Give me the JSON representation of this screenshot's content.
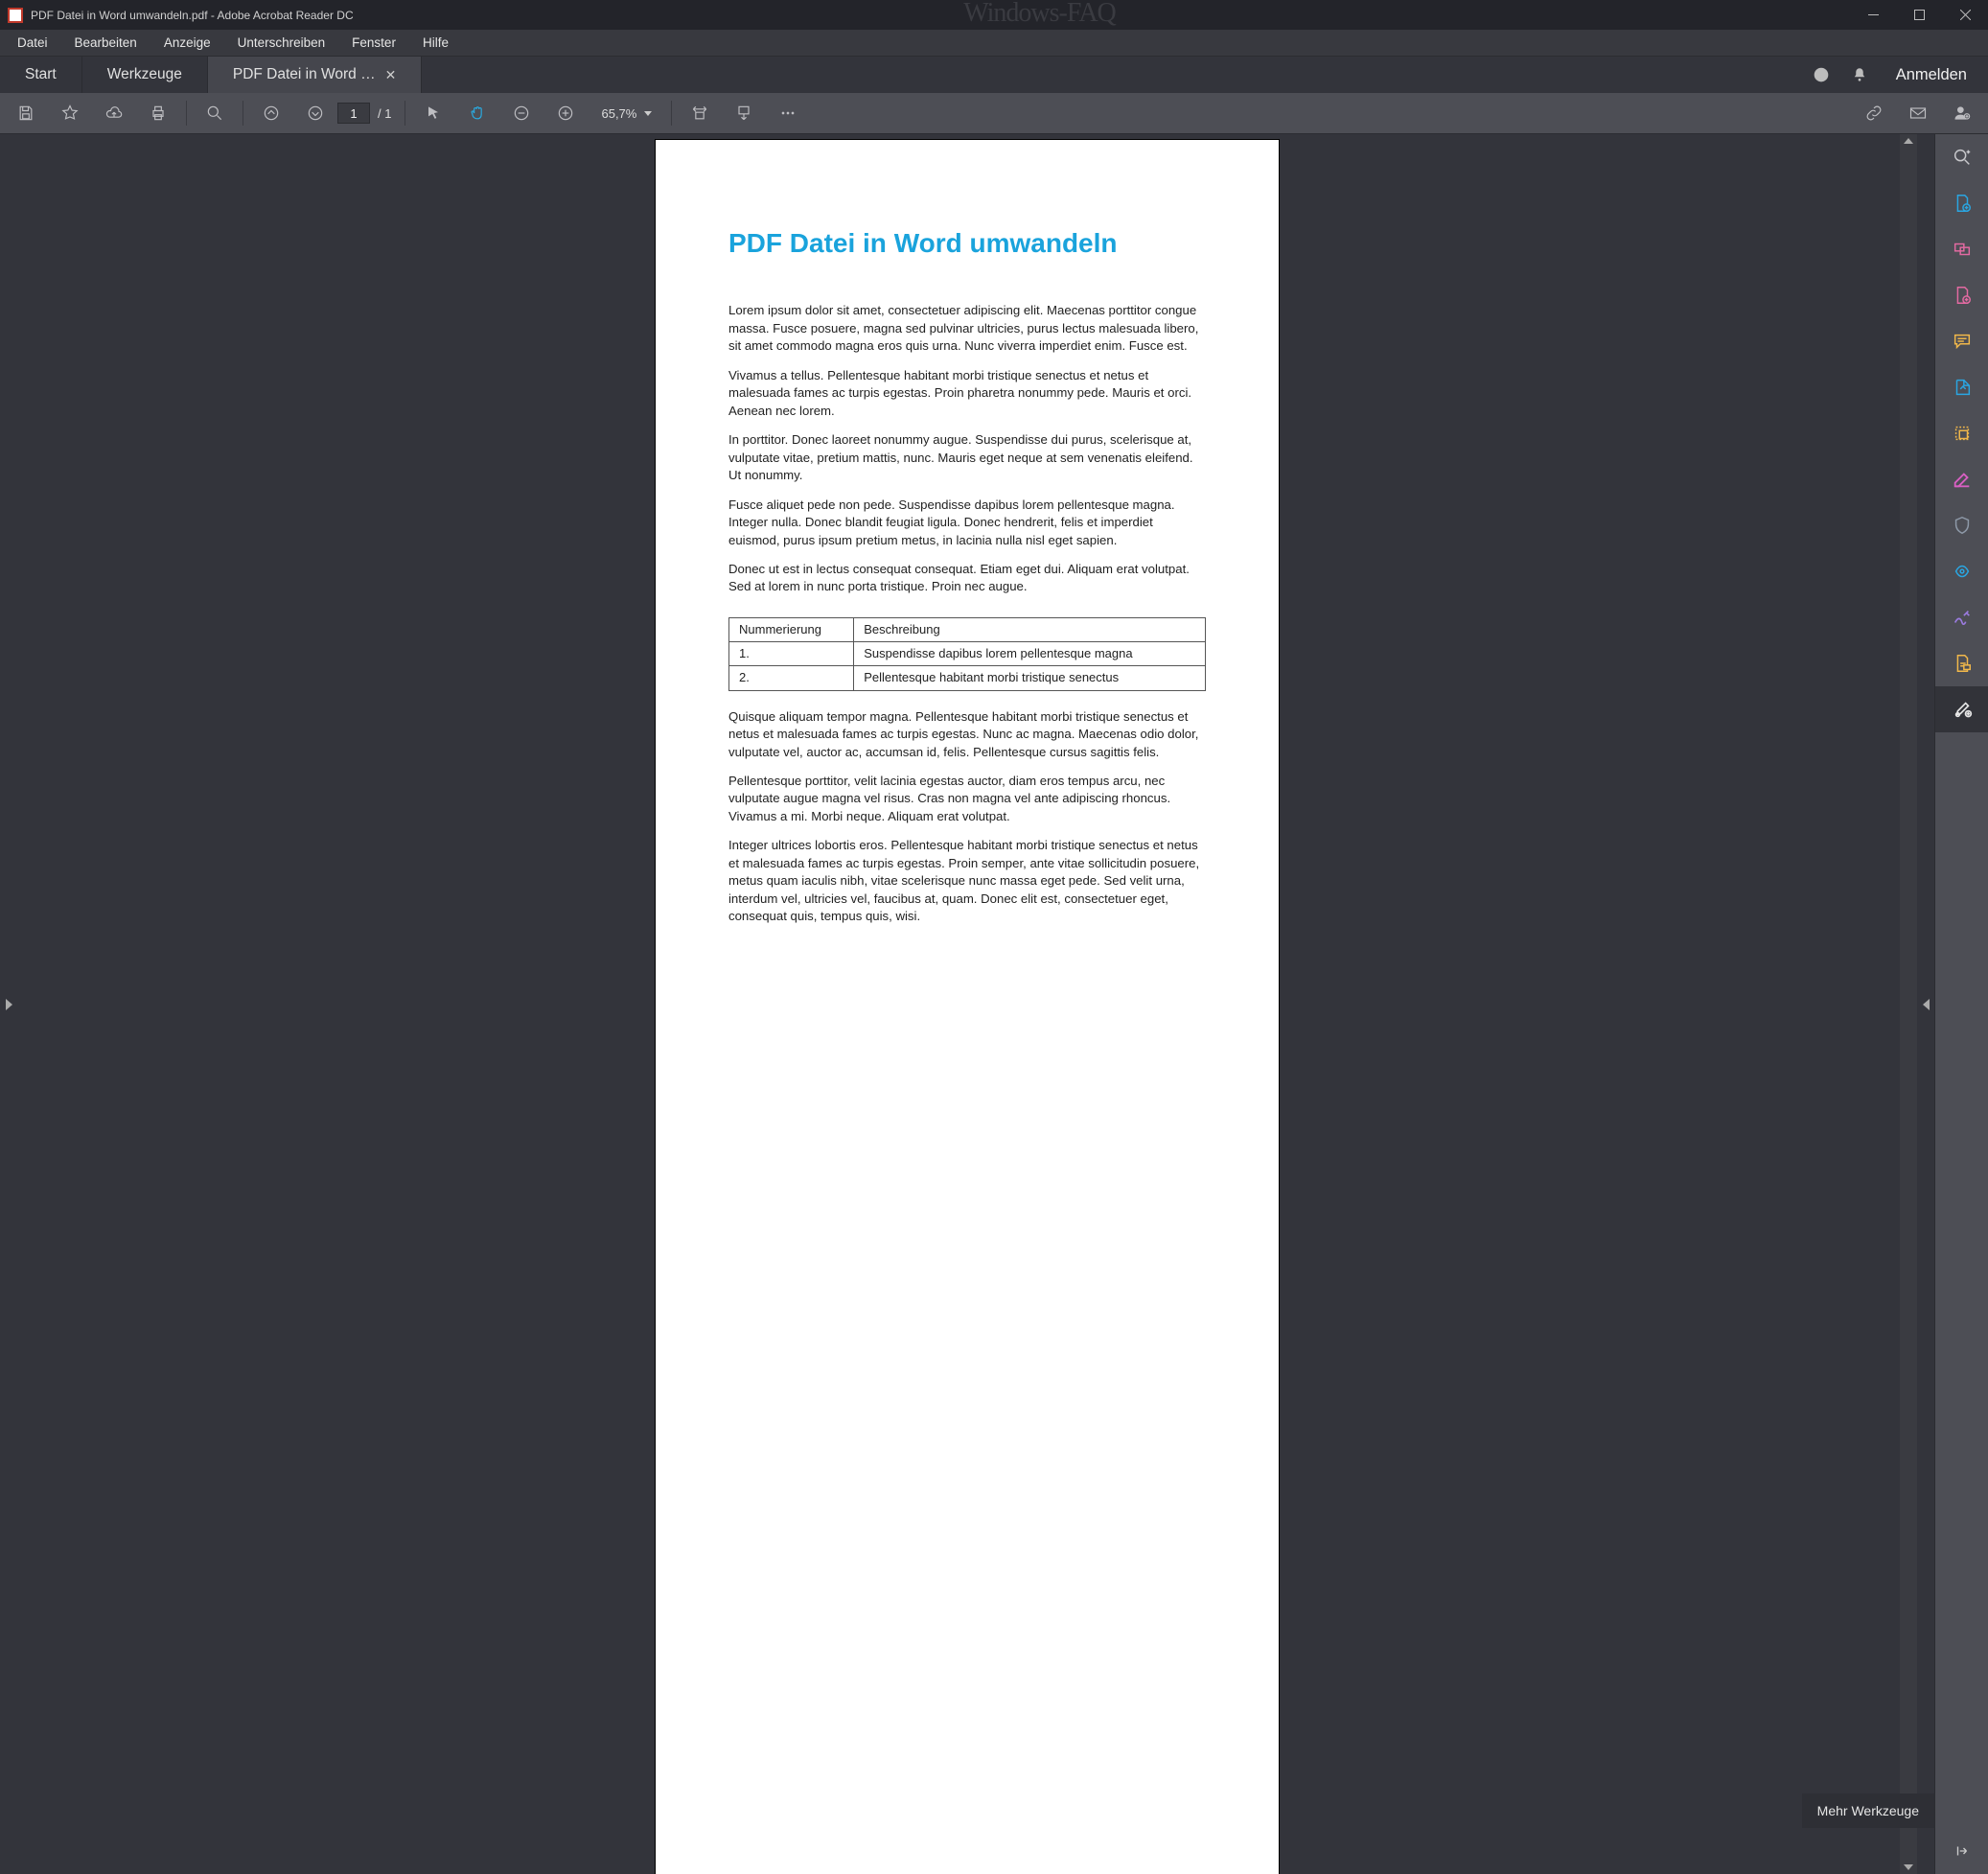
{
  "window": {
    "title": "PDF Datei in Word umwandeln.pdf - Adobe Acrobat Reader DC",
    "watermark": "Windows-FAQ"
  },
  "menu": {
    "datei": "Datei",
    "bearbeiten": "Bearbeiten",
    "anzeige": "Anzeige",
    "unterschreiben": "Unterschreiben",
    "fenster": "Fenster",
    "hilfe": "Hilfe"
  },
  "tabs": {
    "start": "Start",
    "tools": "Werkzeuge",
    "doc": "PDF Datei in Word …"
  },
  "actions": {
    "login": "Anmelden"
  },
  "toolbar": {
    "page_current": "1",
    "page_total_prefix": "/",
    "page_total": "1",
    "zoom": "65,7%"
  },
  "tooltip": {
    "more_tools": "Mehr Werkzeuge"
  },
  "doc": {
    "heading": "PDF Datei in Word umwandeln",
    "p1": "Lorem ipsum dolor sit amet, consectetuer adipiscing elit. Maecenas porttitor congue massa. Fusce posuere, magna sed pulvinar ultricies, purus lectus malesuada libero, sit amet commodo magna eros quis urna. Nunc viverra imperdiet enim. Fusce est.",
    "p2": "Vivamus a tellus. Pellentesque habitant morbi tristique senectus et netus et malesuada fames ac turpis egestas. Proin pharetra nonummy pede. Mauris et orci. Aenean nec lorem.",
    "p3": "In porttitor. Donec laoreet nonummy augue. Suspendisse dui purus, scelerisque at, vulputate vitae, pretium mattis, nunc. Mauris eget neque at sem venenatis eleifend. Ut nonummy.",
    "p4": "Fusce aliquet pede non pede. Suspendisse dapibus lorem pellentesque magna. Integer nulla. Donec blandit feugiat ligula. Donec hendrerit, felis et imperdiet euismod, purus ipsum pretium metus, in lacinia nulla nisl eget sapien.",
    "p5": "Donec ut est in lectus consequat consequat. Etiam eget dui. Aliquam erat volutpat. Sed at lorem in nunc porta tristique. Proin nec augue.",
    "table": {
      "h1": "Nummerierung",
      "h2": "Beschreibung",
      "r1c1": "1.",
      "r1c2": "Suspendisse dapibus lorem pellentesque magna",
      "r2c1": "2.",
      "r2c2": "Pellentesque habitant morbi tristique senectus"
    },
    "p6": "Quisque aliquam tempor magna. Pellentesque habitant morbi tristique senectus et netus et malesuada fames ac turpis egestas. Nunc ac magna. Maecenas odio dolor, vulputate vel, auctor ac, accumsan id, felis. Pellentesque cursus sagittis felis.",
    "p7": "Pellentesque porttitor, velit lacinia egestas auctor, diam eros tempus arcu, nec vulputate augue magna vel risus. Cras non magna vel ante adipiscing rhoncus. Vivamus a mi. Morbi neque. Aliquam erat volutpat.",
    "p8": "Integer ultrices lobortis eros. Pellentesque habitant morbi tristique senectus et netus et malesuada fames ac turpis egestas. Proin semper, ante vitae sollicitudin posuere, metus quam iaculis nibh, vitae scelerisque nunc massa eget pede. Sed velit urna, interdum vel, ultricies vel, faucibus at, quam. Donec elit est, consectetuer eget, consequat quis, tempus quis, wisi."
  }
}
